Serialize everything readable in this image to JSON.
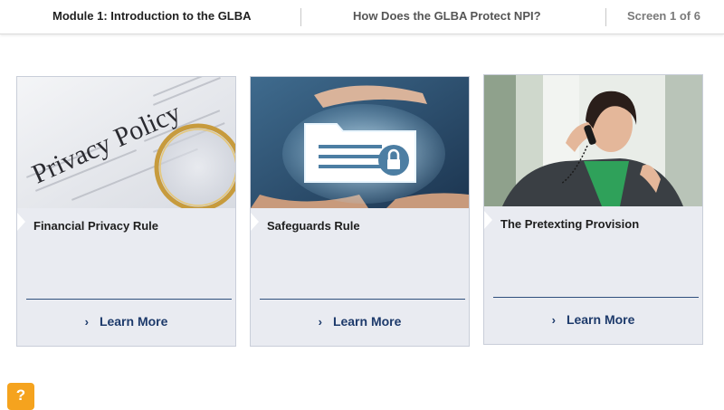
{
  "header": {
    "module_title": "Module 1: Introduction to the GLBA",
    "screen_title": "How Does the GLBA Protect NPI?",
    "screen_counter": "Screen 1 of 6"
  },
  "cards": [
    {
      "title": "Financial Privacy Rule",
      "image_text": "Privacy Policy",
      "link_label": "Learn More",
      "image_icon": "privacy-policy-document-with-magnifying-glass"
    },
    {
      "title": "Safeguards Rule",
      "link_label": "Learn More",
      "image_icon": "hands-holding-locked-folder"
    },
    {
      "title": "The Pretexting Provision",
      "link_label": "Learn More",
      "image_icon": "woman-on-telephone"
    }
  ],
  "help": {
    "label": "?"
  },
  "colors": {
    "card_bg": "#e9ebf1",
    "link": "#1d3a6b",
    "help_bg": "#f5a31e"
  }
}
